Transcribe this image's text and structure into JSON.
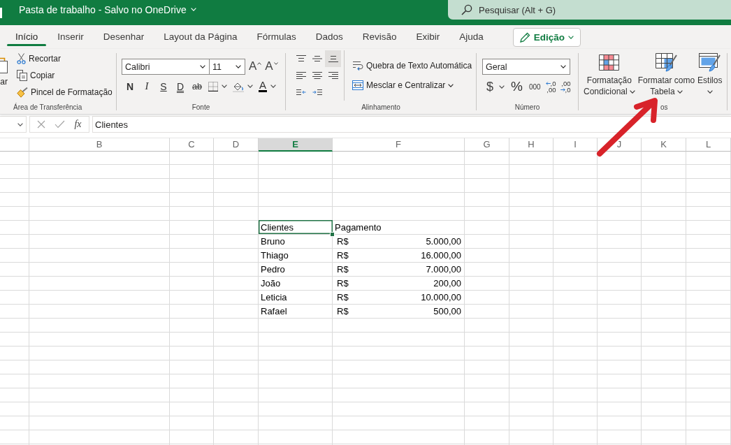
{
  "title_bar": {
    "title": "Pasta de trabalho - Salvo no OneDrive",
    "search": {
      "placeholder": "Pesquisar (Alt + G)"
    }
  },
  "ribbon_tabs": [
    {
      "label": "Início",
      "selected": true
    },
    {
      "label": "Inserir",
      "selected": false
    },
    {
      "label": "Desenhar",
      "selected": false
    },
    {
      "label": "Layout da Página",
      "selected": false
    },
    {
      "label": "Fórmulas",
      "selected": false
    },
    {
      "label": "Dados",
      "selected": false
    },
    {
      "label": "Revisão",
      "selected": false
    },
    {
      "label": "Exibir",
      "selected": false
    },
    {
      "label": "Ajuda",
      "selected": false
    }
  ],
  "mode_button": {
    "label": "Edição"
  },
  "clipboard": {
    "label": "Área de Transferência",
    "paste_label": "ar",
    "commands": [
      {
        "label": "Recortar"
      },
      {
        "label": "Copiar"
      },
      {
        "label": "Pincel de Formatação"
      }
    ]
  },
  "font": {
    "label": "Fonte",
    "font_name": "Calibri",
    "font_size": "11",
    "size_buttons": [
      {
        "label": "A"
      },
      {
        "label": "A"
      }
    ],
    "style_buttons": [
      {
        "label": "N"
      },
      {
        "label": "I"
      },
      {
        "label": "S"
      },
      {
        "label": "D"
      },
      {
        "label": "ab"
      }
    ],
    "font_color_button": {
      "label": "A"
    }
  },
  "alignment": {
    "label": "Alinhamento",
    "vertical": [
      {
        "selected": false
      },
      {
        "selected": false
      },
      {
        "selected": true
      }
    ],
    "horizontal": [
      {
        "selected": false
      },
      {
        "selected": false
      },
      {
        "selected": false
      }
    ],
    "wrap_text": "Quebra de Texto Automática",
    "merge": "Mesclar e Centralizar"
  },
  "number": {
    "label": "Número",
    "format": "Geral",
    "currency": "$",
    "percent": "%",
    "thousands": "000",
    "decimals": [
      {
        "upper": ",0",
        "lower": ",00"
      },
      {
        "upper": ",00",
        "lower": ",0"
      }
    ]
  },
  "styles": {
    "label": "os",
    "buttons": [
      {
        "lines": [
          "Formatação",
          "Condicional"
        ]
      },
      {
        "lines": [
          "Formatar como",
          "Tabela"
        ]
      },
      {
        "lines": [
          "Estilos"
        ]
      }
    ]
  },
  "formula_bar": {
    "function_label": "fx",
    "formula": "Clientes"
  },
  "sheet": {
    "columns": [
      {
        "selected": false
      },
      {
        "label": "B",
        "selected": false
      },
      {
        "label": "C",
        "selected": false
      },
      {
        "label": "D",
        "selected": false
      },
      {
        "label": "E",
        "selected": true
      },
      {
        "label": "F",
        "selected": false
      },
      {
        "label": "G",
        "selected": false
      },
      {
        "label": "H",
        "selected": false
      },
      {
        "label": "I",
        "selected": false
      },
      {
        "label": "J",
        "selected": false
      },
      {
        "label": "K",
        "selected": false
      },
      {
        "label": "L",
        "selected": false
      }
    ],
    "table": {
      "header": [
        {
          "text": "Clientes",
          "selected": true
        },
        {
          "text": "Pagamento",
          "selected": false
        }
      ],
      "rows": [
        {
          "client": "Bruno",
          "currency": "R$",
          "amount": "5.000,00"
        },
        {
          "client": "Thiago",
          "currency": "R$",
          "amount": "16.000,00"
        },
        {
          "client": "Pedro",
          "currency": "R$",
          "amount": "7.000,00"
        },
        {
          "client": "João",
          "currency": "R$",
          "amount": "200,00"
        },
        {
          "client": "Leticia",
          "currency": "R$",
          "amount": "10.000,00"
        },
        {
          "client": "Rafael",
          "currency": "R$",
          "amount": "500,00"
        }
      ]
    }
  }
}
